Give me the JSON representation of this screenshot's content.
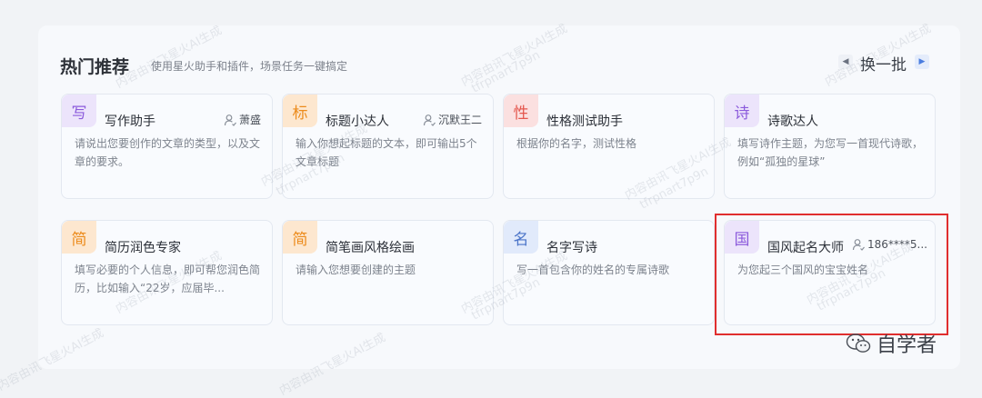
{
  "header": {
    "title": "热门推荐",
    "subtitle": "使用星火助手和插件，场景任务一键搞定",
    "pager_label": "换一批"
  },
  "cards": [
    {
      "badge": "写",
      "badge_color": "purple",
      "name": "写作助手",
      "author": "萧盛",
      "desc": "请说出您要创作的文章的类型，以及文章的要求。"
    },
    {
      "badge": "标",
      "badge_color": "orange",
      "name": "标题小达人",
      "author": "沉默王二",
      "desc": "输入你想起标题的文本，即可输出5个文章标题"
    },
    {
      "badge": "性",
      "badge_color": "red",
      "name": "性格测试助手",
      "author": "",
      "desc": "根据你的名字，测试性格"
    },
    {
      "badge": "诗",
      "badge_color": "purple",
      "name": "诗歌达人",
      "author": "",
      "desc": "填写诗作主题，为您写一首现代诗歌，例如“孤独的星球”"
    },
    {
      "badge": "简",
      "badge_color": "orange",
      "name": "简历润色专家",
      "author": "",
      "desc": "填写必要的个人信息，即可帮您润色简历，比如输入“22岁，应届毕..."
    },
    {
      "badge": "简",
      "badge_color": "orange",
      "name": "简笔画风格绘画",
      "author": "",
      "desc": "请输入您想要创建的主题"
    },
    {
      "badge": "名",
      "badge_color": "blue",
      "name": "名字写诗",
      "author": "",
      "desc": "写一首包含你的姓名的专属诗歌"
    },
    {
      "badge": "国",
      "badge_color": "purple",
      "name": "国风起名大师",
      "author": "186****5...",
      "desc": "为您起三个国风的宝宝姓名"
    }
  ],
  "watermark": {
    "line1": "内容由讯飞星火AI生成",
    "line2": "tfrpnart7p9n"
  },
  "brand": {
    "name": "自学者"
  }
}
